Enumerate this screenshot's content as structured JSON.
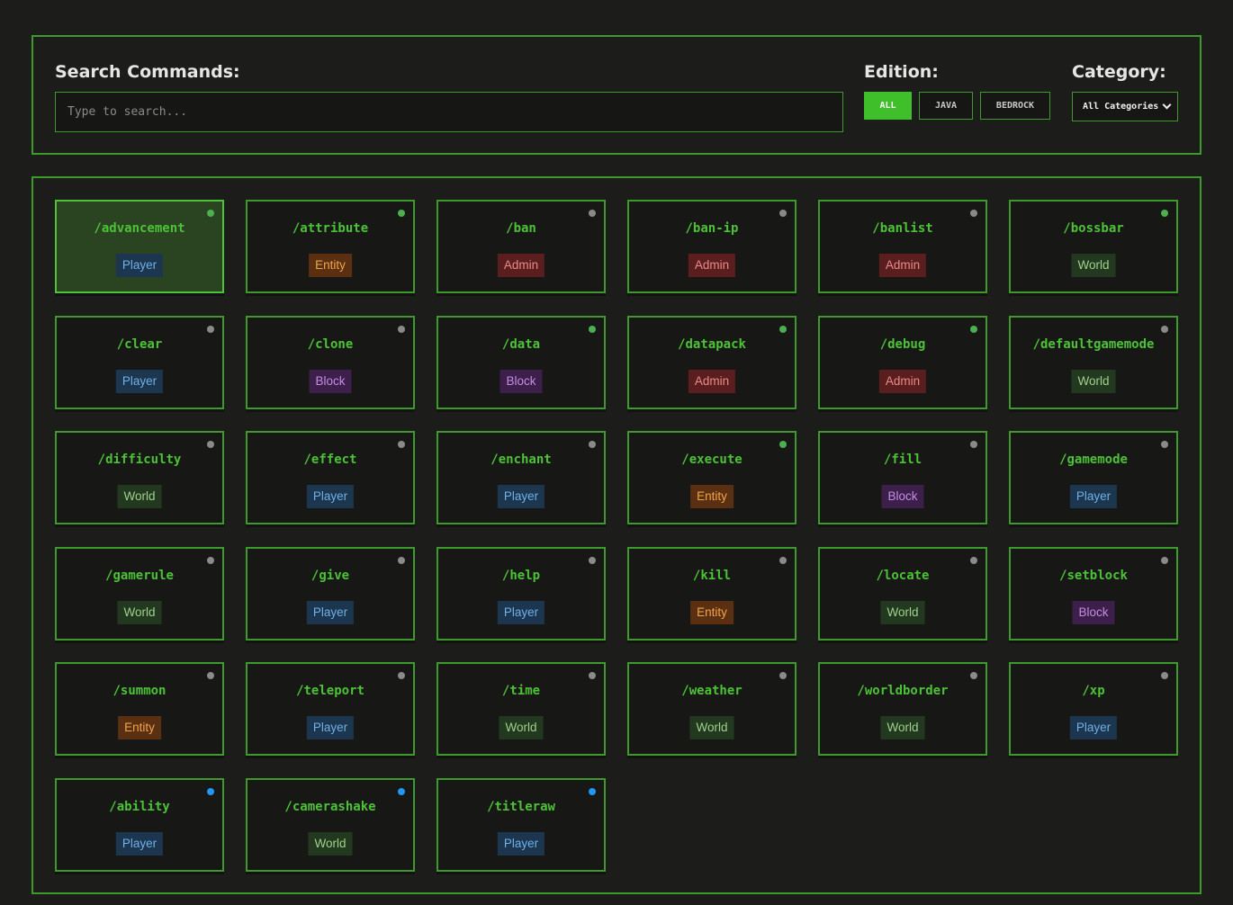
{
  "filters": {
    "search_label": "Search Commands:",
    "search_placeholder": "Type to search...",
    "edition_label": "Edition:",
    "edition_buttons": [
      "ALL",
      "JAVA",
      "BEDROCK"
    ],
    "edition_selected": "ALL",
    "category_label": "Category:",
    "category_selected": "All Categories"
  },
  "colors": {
    "accent": "#3f9a2e",
    "command_text": "#4cc236",
    "dot_java": "#4caf50",
    "dot_both": "#8a8a8a",
    "dot_bedrock": "#2196f3",
    "badge": {
      "Player": {
        "bg": "#1c3650",
        "fg": "#6fb0e6"
      },
      "Entity": {
        "bg": "#5a2f12",
        "fg": "#f0a54a"
      },
      "Admin": {
        "bg": "#5a1e1e",
        "fg": "#ea8a8a"
      },
      "World": {
        "bg": "#23391f",
        "fg": "#9fd08c"
      },
      "Block": {
        "bg": "#3c1f4a",
        "fg": "#c58ee0"
      }
    }
  },
  "commands": [
    {
      "name": "/advancement",
      "category": "Player",
      "dot": "dot_java",
      "selected": true
    },
    {
      "name": "/attribute",
      "category": "Entity",
      "dot": "dot_java"
    },
    {
      "name": "/ban",
      "category": "Admin",
      "dot": "dot_both"
    },
    {
      "name": "/ban-ip",
      "category": "Admin",
      "dot": "dot_both"
    },
    {
      "name": "/banlist",
      "category": "Admin",
      "dot": "dot_both"
    },
    {
      "name": "/bossbar",
      "category": "World",
      "dot": "dot_java"
    },
    {
      "name": "/clear",
      "category": "Player",
      "dot": "dot_both"
    },
    {
      "name": "/clone",
      "category": "Block",
      "dot": "dot_both"
    },
    {
      "name": "/data",
      "category": "Block",
      "dot": "dot_java"
    },
    {
      "name": "/datapack",
      "category": "Admin",
      "dot": "dot_java"
    },
    {
      "name": "/debug",
      "category": "Admin",
      "dot": "dot_java"
    },
    {
      "name": "/defaultgamemode",
      "category": "World",
      "dot": "dot_both"
    },
    {
      "name": "/difficulty",
      "category": "World",
      "dot": "dot_both"
    },
    {
      "name": "/effect",
      "category": "Player",
      "dot": "dot_both"
    },
    {
      "name": "/enchant",
      "category": "Player",
      "dot": "dot_both"
    },
    {
      "name": "/execute",
      "category": "Entity",
      "dot": "dot_java"
    },
    {
      "name": "/fill",
      "category": "Block",
      "dot": "dot_both"
    },
    {
      "name": "/gamemode",
      "category": "Player",
      "dot": "dot_both"
    },
    {
      "name": "/gamerule",
      "category": "World",
      "dot": "dot_both"
    },
    {
      "name": "/give",
      "category": "Player",
      "dot": "dot_both"
    },
    {
      "name": "/help",
      "category": "Player",
      "dot": "dot_both"
    },
    {
      "name": "/kill",
      "category": "Entity",
      "dot": "dot_both"
    },
    {
      "name": "/locate",
      "category": "World",
      "dot": "dot_both"
    },
    {
      "name": "/setblock",
      "category": "Block",
      "dot": "dot_both"
    },
    {
      "name": "/summon",
      "category": "Entity",
      "dot": "dot_both"
    },
    {
      "name": "/teleport",
      "category": "Player",
      "dot": "dot_both"
    },
    {
      "name": "/time",
      "category": "World",
      "dot": "dot_both"
    },
    {
      "name": "/weather",
      "category": "World",
      "dot": "dot_both"
    },
    {
      "name": "/worldborder",
      "category": "World",
      "dot": "dot_both"
    },
    {
      "name": "/xp",
      "category": "Player",
      "dot": "dot_both"
    },
    {
      "name": "/ability",
      "category": "Player",
      "dot": "dot_bedrock"
    },
    {
      "name": "/camerashake",
      "category": "World",
      "dot": "dot_bedrock"
    },
    {
      "name": "/titleraw",
      "category": "Player",
      "dot": "dot_bedrock"
    }
  ]
}
